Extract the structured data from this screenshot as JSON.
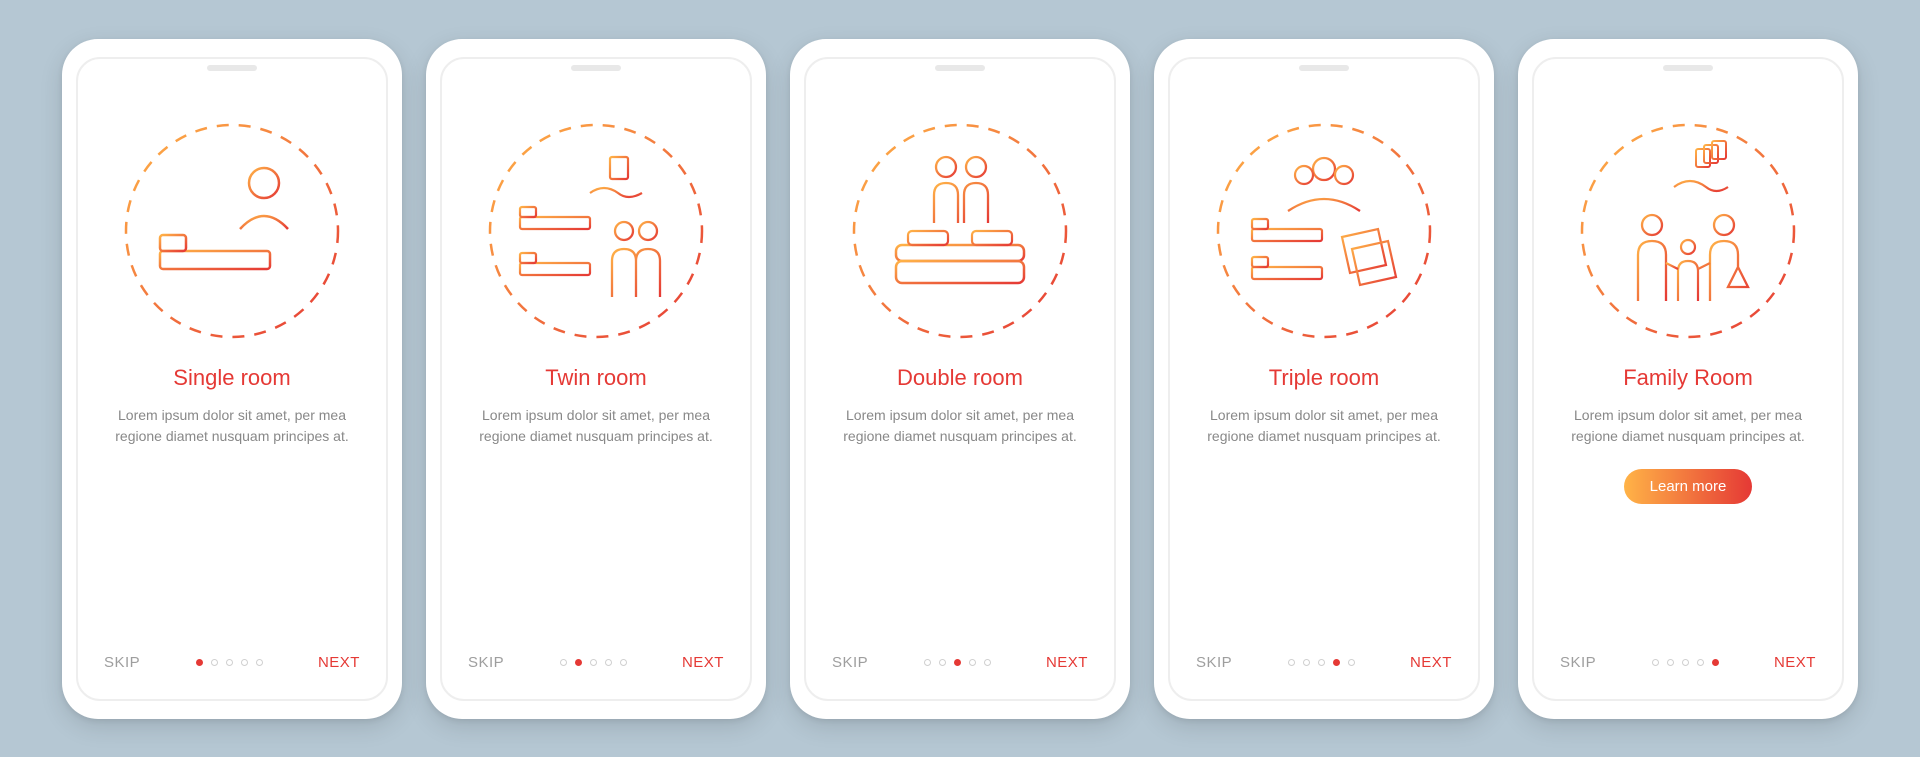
{
  "common": {
    "skip_label": "SKIP",
    "next_label": "NEXT",
    "description": "Lorem ipsum dolor sit amet, per mea regione diamet nusquam principes at.",
    "learn_more_label": "Learn more",
    "dot_count": 5
  },
  "screens": [
    {
      "id": "single",
      "title": "Single room",
      "icon": "single-room-icon",
      "active_dot": 0,
      "has_cta": false
    },
    {
      "id": "twin",
      "title": "Twin room",
      "icon": "twin-room-icon",
      "active_dot": 1,
      "has_cta": false
    },
    {
      "id": "double",
      "title": "Double room",
      "icon": "double-room-icon",
      "active_dot": 2,
      "has_cta": false
    },
    {
      "id": "triple",
      "title": "Triple room",
      "icon": "triple-room-icon",
      "active_dot": 3,
      "has_cta": false
    },
    {
      "id": "family",
      "title": "Family Room",
      "icon": "family-room-icon",
      "active_dot": 4,
      "has_cta": true
    }
  ],
  "colors": {
    "accent": "#e53935",
    "grad_start": "#ffb347",
    "grad_end": "#e53935",
    "bg": "#b5c7d3"
  }
}
